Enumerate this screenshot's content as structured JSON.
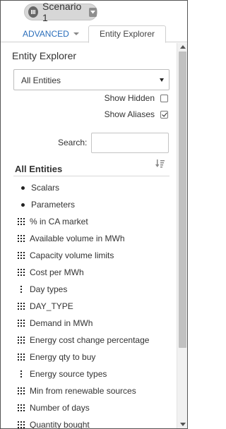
{
  "header": {
    "scenario_label": "Scenario 1",
    "scenario_icon": "scenario-icon",
    "caret_icon": "chevron-down-icon"
  },
  "tabs": {
    "advanced_label": "ADVANCED",
    "entity_explorer_label": "Entity Explorer",
    "active": "Entity Explorer"
  },
  "panel": {
    "title": "Entity Explorer",
    "filter_select_value": "All Entities",
    "show_hidden": {
      "label": "Show Hidden",
      "checked": false
    },
    "show_aliases": {
      "label": "Show Aliases",
      "checked": true
    },
    "search_label": "Search:",
    "search_value": "",
    "list_header": "All Entities",
    "sort_icon": "sort-icon"
  },
  "entities": [
    {
      "label": "Scalars",
      "icon": "bullet"
    },
    {
      "label": "Parameters",
      "icon": "bullet"
    },
    {
      "label": "% in CA market",
      "icon": "grid"
    },
    {
      "label": "Available volume in MWh",
      "icon": "grid"
    },
    {
      "label": "Capacity volume limits",
      "icon": "grid"
    },
    {
      "label": "Cost per MWh",
      "icon": "grid"
    },
    {
      "label": "Day types",
      "icon": "vdots"
    },
    {
      "label": "DAY_TYPE",
      "icon": "grid"
    },
    {
      "label": "Demand in MWh",
      "icon": "grid"
    },
    {
      "label": "Energy cost change percentage",
      "icon": "grid"
    },
    {
      "label": "Energy qty to buy",
      "icon": "grid"
    },
    {
      "label": "Energy source types",
      "icon": "vdots"
    },
    {
      "label": "Min from renewable sources",
      "icon": "grid"
    },
    {
      "label": "Number of days",
      "icon": "grid"
    },
    {
      "label": "Quantity bought",
      "icon": "grid"
    }
  ],
  "colors": {
    "accent_link": "#2a6ebb",
    "pill_bg": "#d7d7d7",
    "scrollbar_thumb": "#c1c1c1"
  }
}
